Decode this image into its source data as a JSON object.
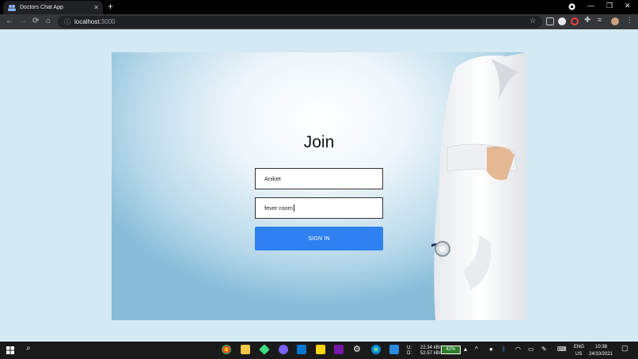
{
  "browser": {
    "tab_title": "Doctors Chat App",
    "tab_close": "✕",
    "new_tab": "+",
    "url_host": "localhost",
    "url_port": ":3000",
    "window_minimize": "—",
    "window_restore": "❐",
    "window_close": "✕"
  },
  "page": {
    "heading": "Join",
    "name_value": "Aniket",
    "room_value": "fever  room",
    "signin_label": "SIGN IN"
  },
  "taskbar": {
    "net_up_label": "U:",
    "net_down_label": "D:",
    "net_up": "22.34 kB/s",
    "net_down": "52.57 kB/s",
    "battery": "42%",
    "lang": "ENG",
    "region": "US",
    "time": "10:38",
    "date": "24/10/2021"
  },
  "colors": {
    "accent": "#2f80f0",
    "page_bg": "#d3e9f3"
  }
}
